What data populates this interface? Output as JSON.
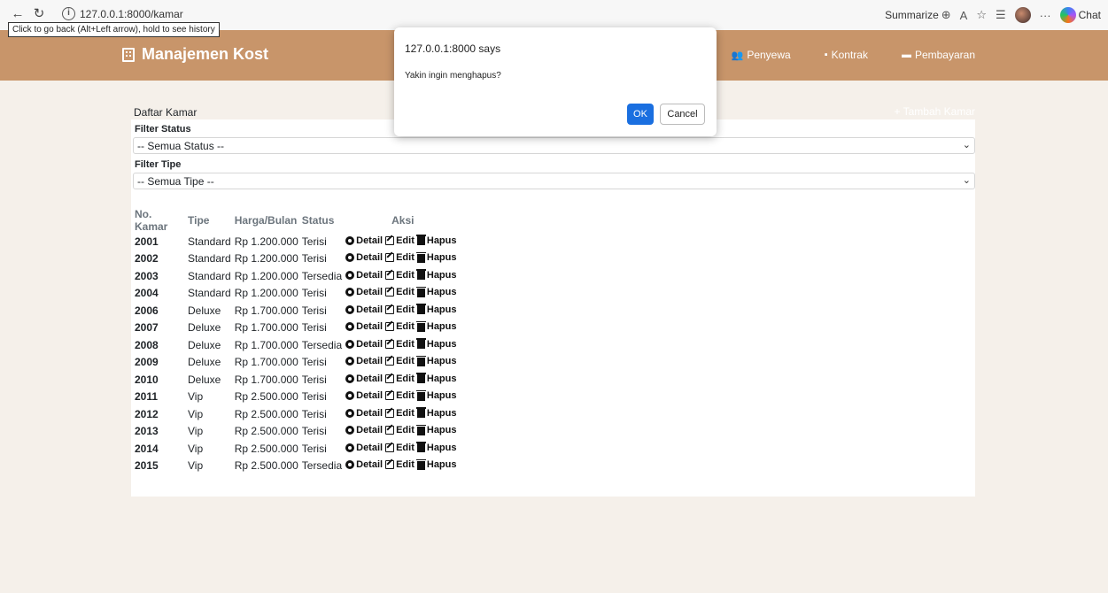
{
  "browser": {
    "url": "127.0.0.1:8000/kamar",
    "tooltip": "Click to go back (Alt+Left arrow), hold to see history",
    "summarize_label": "Summarize",
    "chat_label": "Chat"
  },
  "nav": {
    "brand": "Manajemen Kost",
    "links": [
      "Penyewa",
      "Kontrak",
      "Pembayaran"
    ]
  },
  "card": {
    "title": "Daftar Kamar",
    "add_label": "+ Tambah Kamar"
  },
  "filters": {
    "status_label": "Filter Status",
    "status_value": "-- Semua Status --",
    "tipe_label": "Filter Tipe",
    "tipe_value": "-- Semua Tipe --"
  },
  "table": {
    "headers": [
      "No. Kamar",
      "Tipe",
      "Harga/Bulan",
      "Status",
      "Aksi"
    ],
    "actions": [
      "Detail",
      "Edit",
      "Hapus"
    ],
    "rows": [
      [
        "2001",
        "Standard",
        "Rp 1.200.000",
        "Terisi"
      ],
      [
        "2002",
        "Standard",
        "Rp 1.200.000",
        "Terisi"
      ],
      [
        "2003",
        "Standard",
        "Rp 1.200.000",
        "Tersedia"
      ],
      [
        "2004",
        "Standard",
        "Rp 1.200.000",
        "Terisi"
      ],
      [
        "2006",
        "Deluxe",
        "Rp 1.700.000",
        "Terisi"
      ],
      [
        "2007",
        "Deluxe",
        "Rp 1.700.000",
        "Terisi"
      ],
      [
        "2008",
        "Deluxe",
        "Rp 1.700.000",
        "Tersedia"
      ],
      [
        "2009",
        "Deluxe",
        "Rp 1.700.000",
        "Terisi"
      ],
      [
        "2010",
        "Deluxe",
        "Rp 1.700.000",
        "Terisi"
      ],
      [
        "2011",
        "Vip",
        "Rp 2.500.000",
        "Terisi"
      ],
      [
        "2012",
        "Vip",
        "Rp 2.500.000",
        "Terisi"
      ],
      [
        "2013",
        "Vip",
        "Rp 2.500.000",
        "Terisi"
      ],
      [
        "2014",
        "Vip",
        "Rp 2.500.000",
        "Terisi"
      ],
      [
        "2015",
        "Vip",
        "Rp 2.500.000",
        "Tersedia"
      ]
    ]
  },
  "dialog": {
    "title": "127.0.0.1:8000 says",
    "message": "Yakin ingin menghapus?",
    "ok_label": "OK",
    "cancel_label": "Cancel"
  },
  "colors": {
    "nav_bg": "#c8956a",
    "page_bg": "#f5f0ea",
    "ok_button": "#1a6fe0"
  }
}
